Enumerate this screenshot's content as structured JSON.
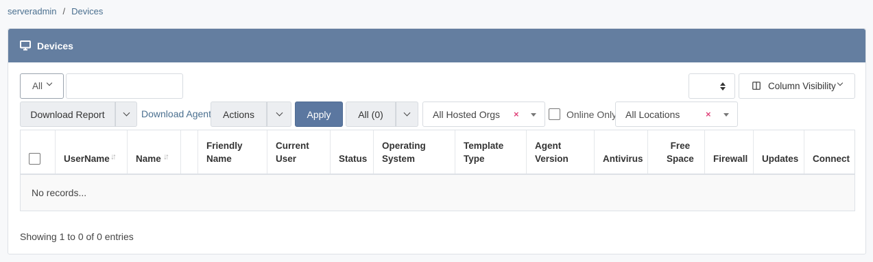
{
  "breadcrumb": {
    "root": "serveradmin",
    "separator": "/",
    "current": "Devices"
  },
  "header": {
    "title": "Devices",
    "icon": "monitor-icon"
  },
  "toolbar": {
    "filter_select": "All",
    "search_value": "",
    "page_length": "",
    "column_visibility": "Column Visibility",
    "download_report": "Download Report",
    "download_agent": "Download Agent",
    "actions": "Actions",
    "apply": "Apply",
    "status_filter": "All (0)",
    "orgs_select": "All Hosted Orgs",
    "orgs_clear": "×",
    "online_only": "Online Only",
    "locations_select": "All Locations",
    "locations_clear": "×"
  },
  "table": {
    "columns": [
      {
        "label": ""
      },
      {
        "label": "UserName",
        "sort": "↓↑"
      },
      {
        "label": "Name",
        "sort": "↓↑"
      },
      {
        "label": ""
      },
      {
        "label": "Friendly\nName"
      },
      {
        "label": "Current\nUser"
      },
      {
        "label": "Status"
      },
      {
        "label": "Operating\nSystem"
      },
      {
        "label": "Template\nType"
      },
      {
        "label": "Agent\nVersion"
      },
      {
        "label": "Antivirus"
      },
      {
        "label": "Free\nSpace"
      },
      {
        "label": "Firewall"
      },
      {
        "label": "Updates"
      },
      {
        "label": "Connect"
      }
    ],
    "empty_message": "No records..."
  },
  "footer": {
    "info": "Showing 1 to 0 of 0 entries"
  }
}
